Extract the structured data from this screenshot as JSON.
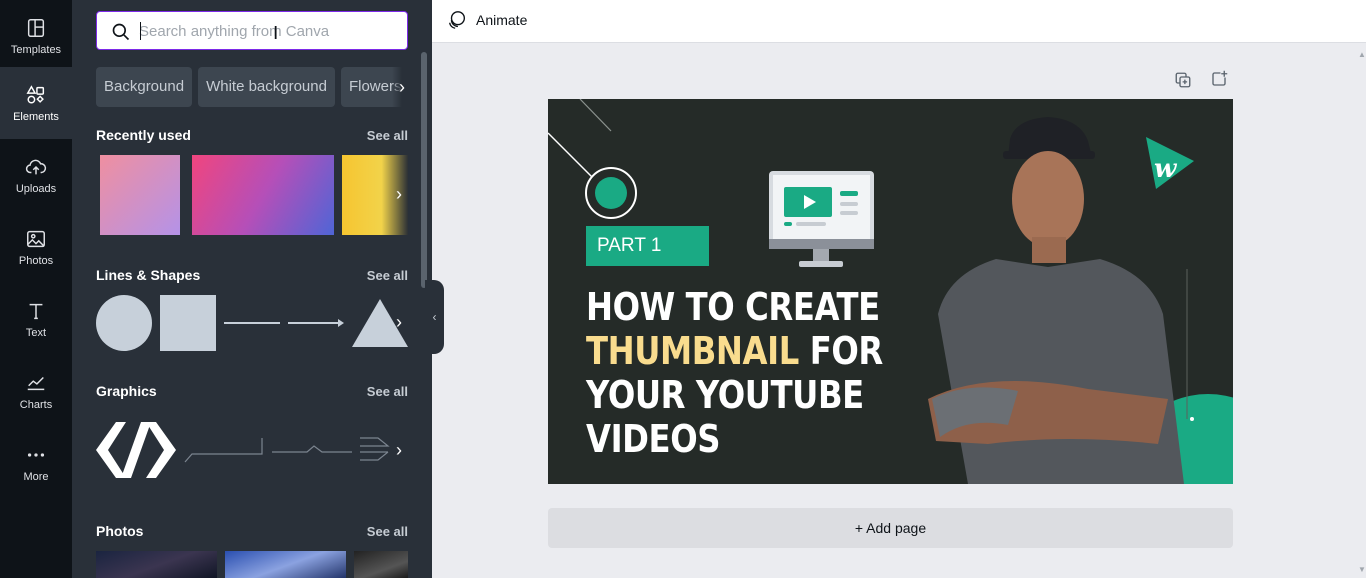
{
  "rail": {
    "items": [
      {
        "label": "Templates",
        "icon": "templates-icon"
      },
      {
        "label": "Elements",
        "icon": "elements-icon",
        "active": true
      },
      {
        "label": "Uploads",
        "icon": "uploads-icon"
      },
      {
        "label": "Photos",
        "icon": "photos-icon"
      },
      {
        "label": "Text",
        "icon": "text-icon"
      },
      {
        "label": "Charts",
        "icon": "charts-icon"
      },
      {
        "label": "More",
        "icon": "more-icon"
      }
    ]
  },
  "search": {
    "placeholder": "Search anything from Canva",
    "value": ""
  },
  "chips": [
    "Background",
    "White background",
    "Flowers"
  ],
  "sections": {
    "recently_used": {
      "title": "Recently used",
      "see_all": "See all"
    },
    "lines_shapes": {
      "title": "Lines & Shapes",
      "see_all": "See all"
    },
    "graphics": {
      "title": "Graphics",
      "see_all": "See all"
    },
    "photos": {
      "title": "Photos",
      "see_all": "See all"
    }
  },
  "topbar": {
    "animate_label": "Animate"
  },
  "design": {
    "part_label": "PART 1",
    "headline_line1": "HOW TO CREATE",
    "headline_highlight": "THUMBNAIL",
    "headline_line2_rest": " FOR",
    "headline_line3": "YOUR YOUTUBE",
    "headline_line4": "VIDEOS"
  },
  "add_page_label": "+ Add page",
  "colors": {
    "accent": "#7d2ae8",
    "brand_green": "#1aaa84",
    "highlight": "#f9dc8e",
    "canvas_bg": "#252b28"
  }
}
